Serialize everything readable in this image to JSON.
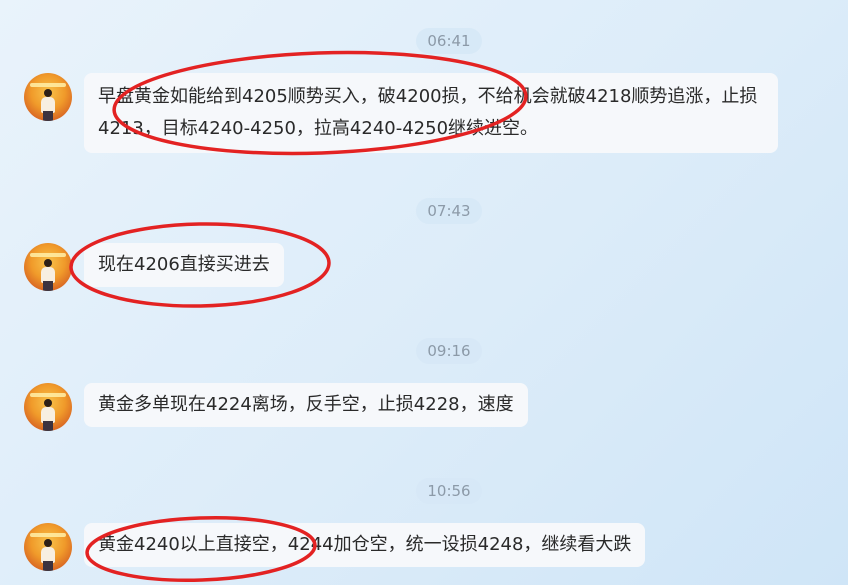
{
  "messages": [
    {
      "time": "06:41",
      "text": "早盘黄金如能给到4205顺势买入，破4200损，不给机会就破4218顺势追涨，止损4213，目标4240-4250，拉高4240-4250继续进空。"
    },
    {
      "time": "07:43",
      "text": "现在4206直接买进去"
    },
    {
      "time": "09:16",
      "text": "黄金多单现在4224离场，反手空，止损4228，速度"
    },
    {
      "time": "10:56",
      "text": "黄金4240以上直接空，4244加仓空，统一设损4248，继续看大跌"
    }
  ],
  "colors": {
    "annotation_red": "#e32222",
    "bubble_bg": "#f6f8fb",
    "timestamp_text": "#8c9aa8"
  }
}
